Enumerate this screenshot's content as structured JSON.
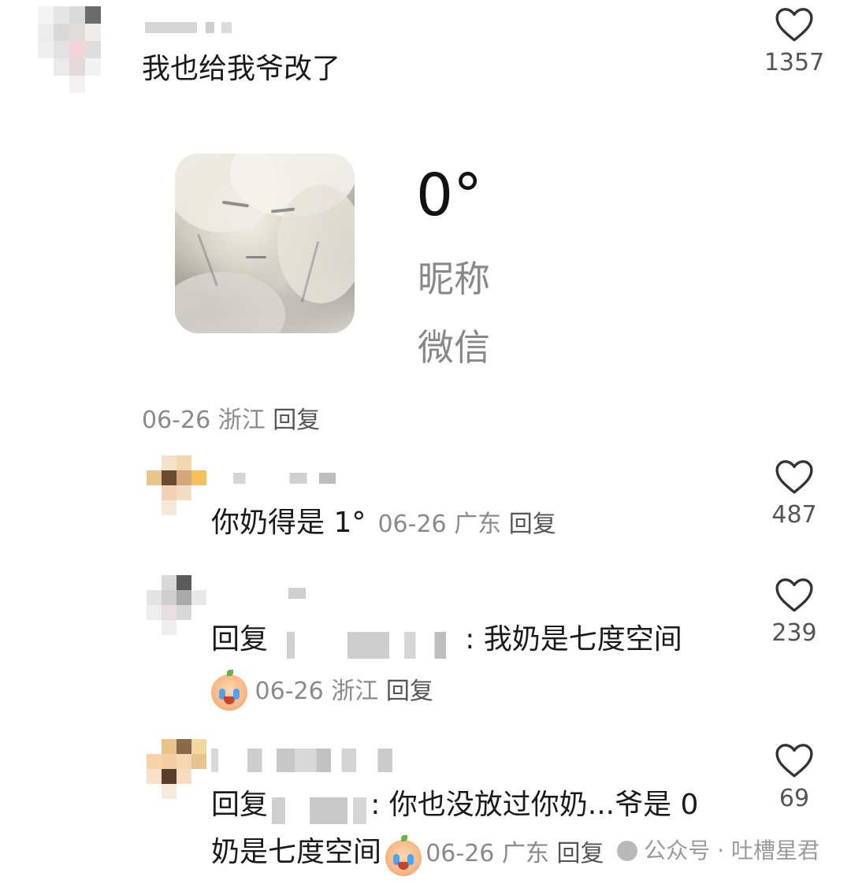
{
  "top_comment": {
    "text": "我也给我爷改了",
    "likes": "1357",
    "date": "06-26",
    "region": "浙江",
    "reply_label": "回复",
    "card": {
      "temperature": "0°",
      "nickname": "昵称",
      "app": "微信"
    }
  },
  "replies": [
    {
      "text": "你奶得是 1°",
      "date": "06-26",
      "region": "广东",
      "reply_label": "回复",
      "likes": "487"
    },
    {
      "prefix": "回复",
      "text": ": 我奶是七度空间",
      "date": "06-26",
      "region": "浙江",
      "reply_label": "回复",
      "likes": "239"
    },
    {
      "prefix": "回复",
      "text": ": 你也没放过你奶...爷是 0",
      "text2": "奶是七度空间",
      "date": "06-26",
      "region": "广东",
      "reply_label": "回复",
      "likes": "69"
    }
  ],
  "watermark": "公众号 · 吐槽星君",
  "colors": {
    "like_outline": "#333333",
    "meta_gray": "#8a8a8a"
  },
  "icons": [
    "heart-outline-icon",
    "crying-face-emoji-icon"
  ]
}
